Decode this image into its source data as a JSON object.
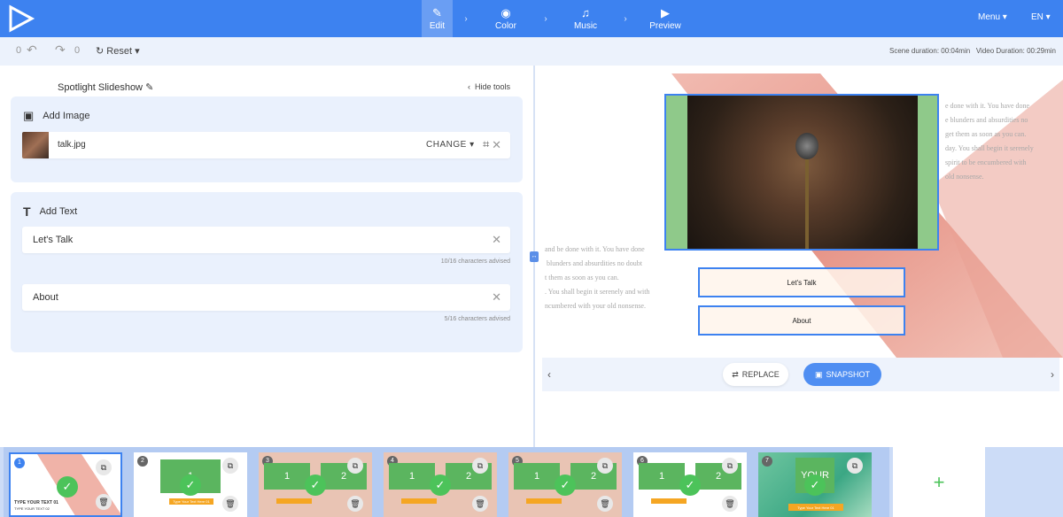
{
  "nav": {
    "steps": [
      {
        "label": "Edit",
        "icon": "pencil-icon"
      },
      {
        "label": "Color",
        "icon": "palette-icon"
      },
      {
        "label": "Music",
        "icon": "music-note-icon"
      },
      {
        "label": "Preview",
        "icon": "play-icon"
      }
    ],
    "menu": "Menu",
    "lang": "EN"
  },
  "toolbar": {
    "undo_count": "0",
    "redo_count": "0",
    "reset": "Reset",
    "scene_duration": "Scene duration: 00:04min",
    "video_duration": "Video Duration: 00:29min"
  },
  "editor": {
    "title": "Spotlight Slideshow",
    "hide_tools": "Hide tools",
    "image_section": {
      "heading": "Add Image",
      "filename": "talk.jpg",
      "change": "CHANGE"
    },
    "text_section": {
      "heading": "Add Text",
      "fields": [
        {
          "value": "Let's Talk",
          "hint": "10/16 characters advised"
        },
        {
          "value": "About",
          "hint": "5/16 characters advised"
        }
      ]
    }
  },
  "preview": {
    "bg_text_right": "e done with it. You have done\ne blunders and absurdities no\nget them as soon as you can.\nday. You shall begin it serenely\nspirit to be encumbered with\nold nonsense.",
    "bg_text_left": "and be done with it. You have done\n blunders and absurdities no doubt\nt them as soon as you can.\n. You shall begin it serenely and with\nncumbered with your old nonsense.",
    "text_box_1": "Let's Talk",
    "text_box_2": "About",
    "replace": "REPLACE",
    "snapshot": "SNAPSHOT"
  },
  "filmstrip": {
    "scenes": [
      {
        "num": "1",
        "caption": "TYPE YOUR TEXT 01",
        "sub": "TYPE YOUR TEXT 02"
      },
      {
        "num": "2",
        "big": "1",
        "small": "Type Your Text Here 01"
      },
      {
        "num": "3",
        "a": "1",
        "b": "2"
      },
      {
        "num": "4",
        "a": "1",
        "b": "2"
      },
      {
        "num": "5",
        "a": "1",
        "b": "2"
      },
      {
        "num": "6",
        "a": "1",
        "b": "2"
      },
      {
        "num": "7",
        "big": "YOUR",
        "small": "Type Your Text Here 01"
      }
    ],
    "add": "+"
  }
}
